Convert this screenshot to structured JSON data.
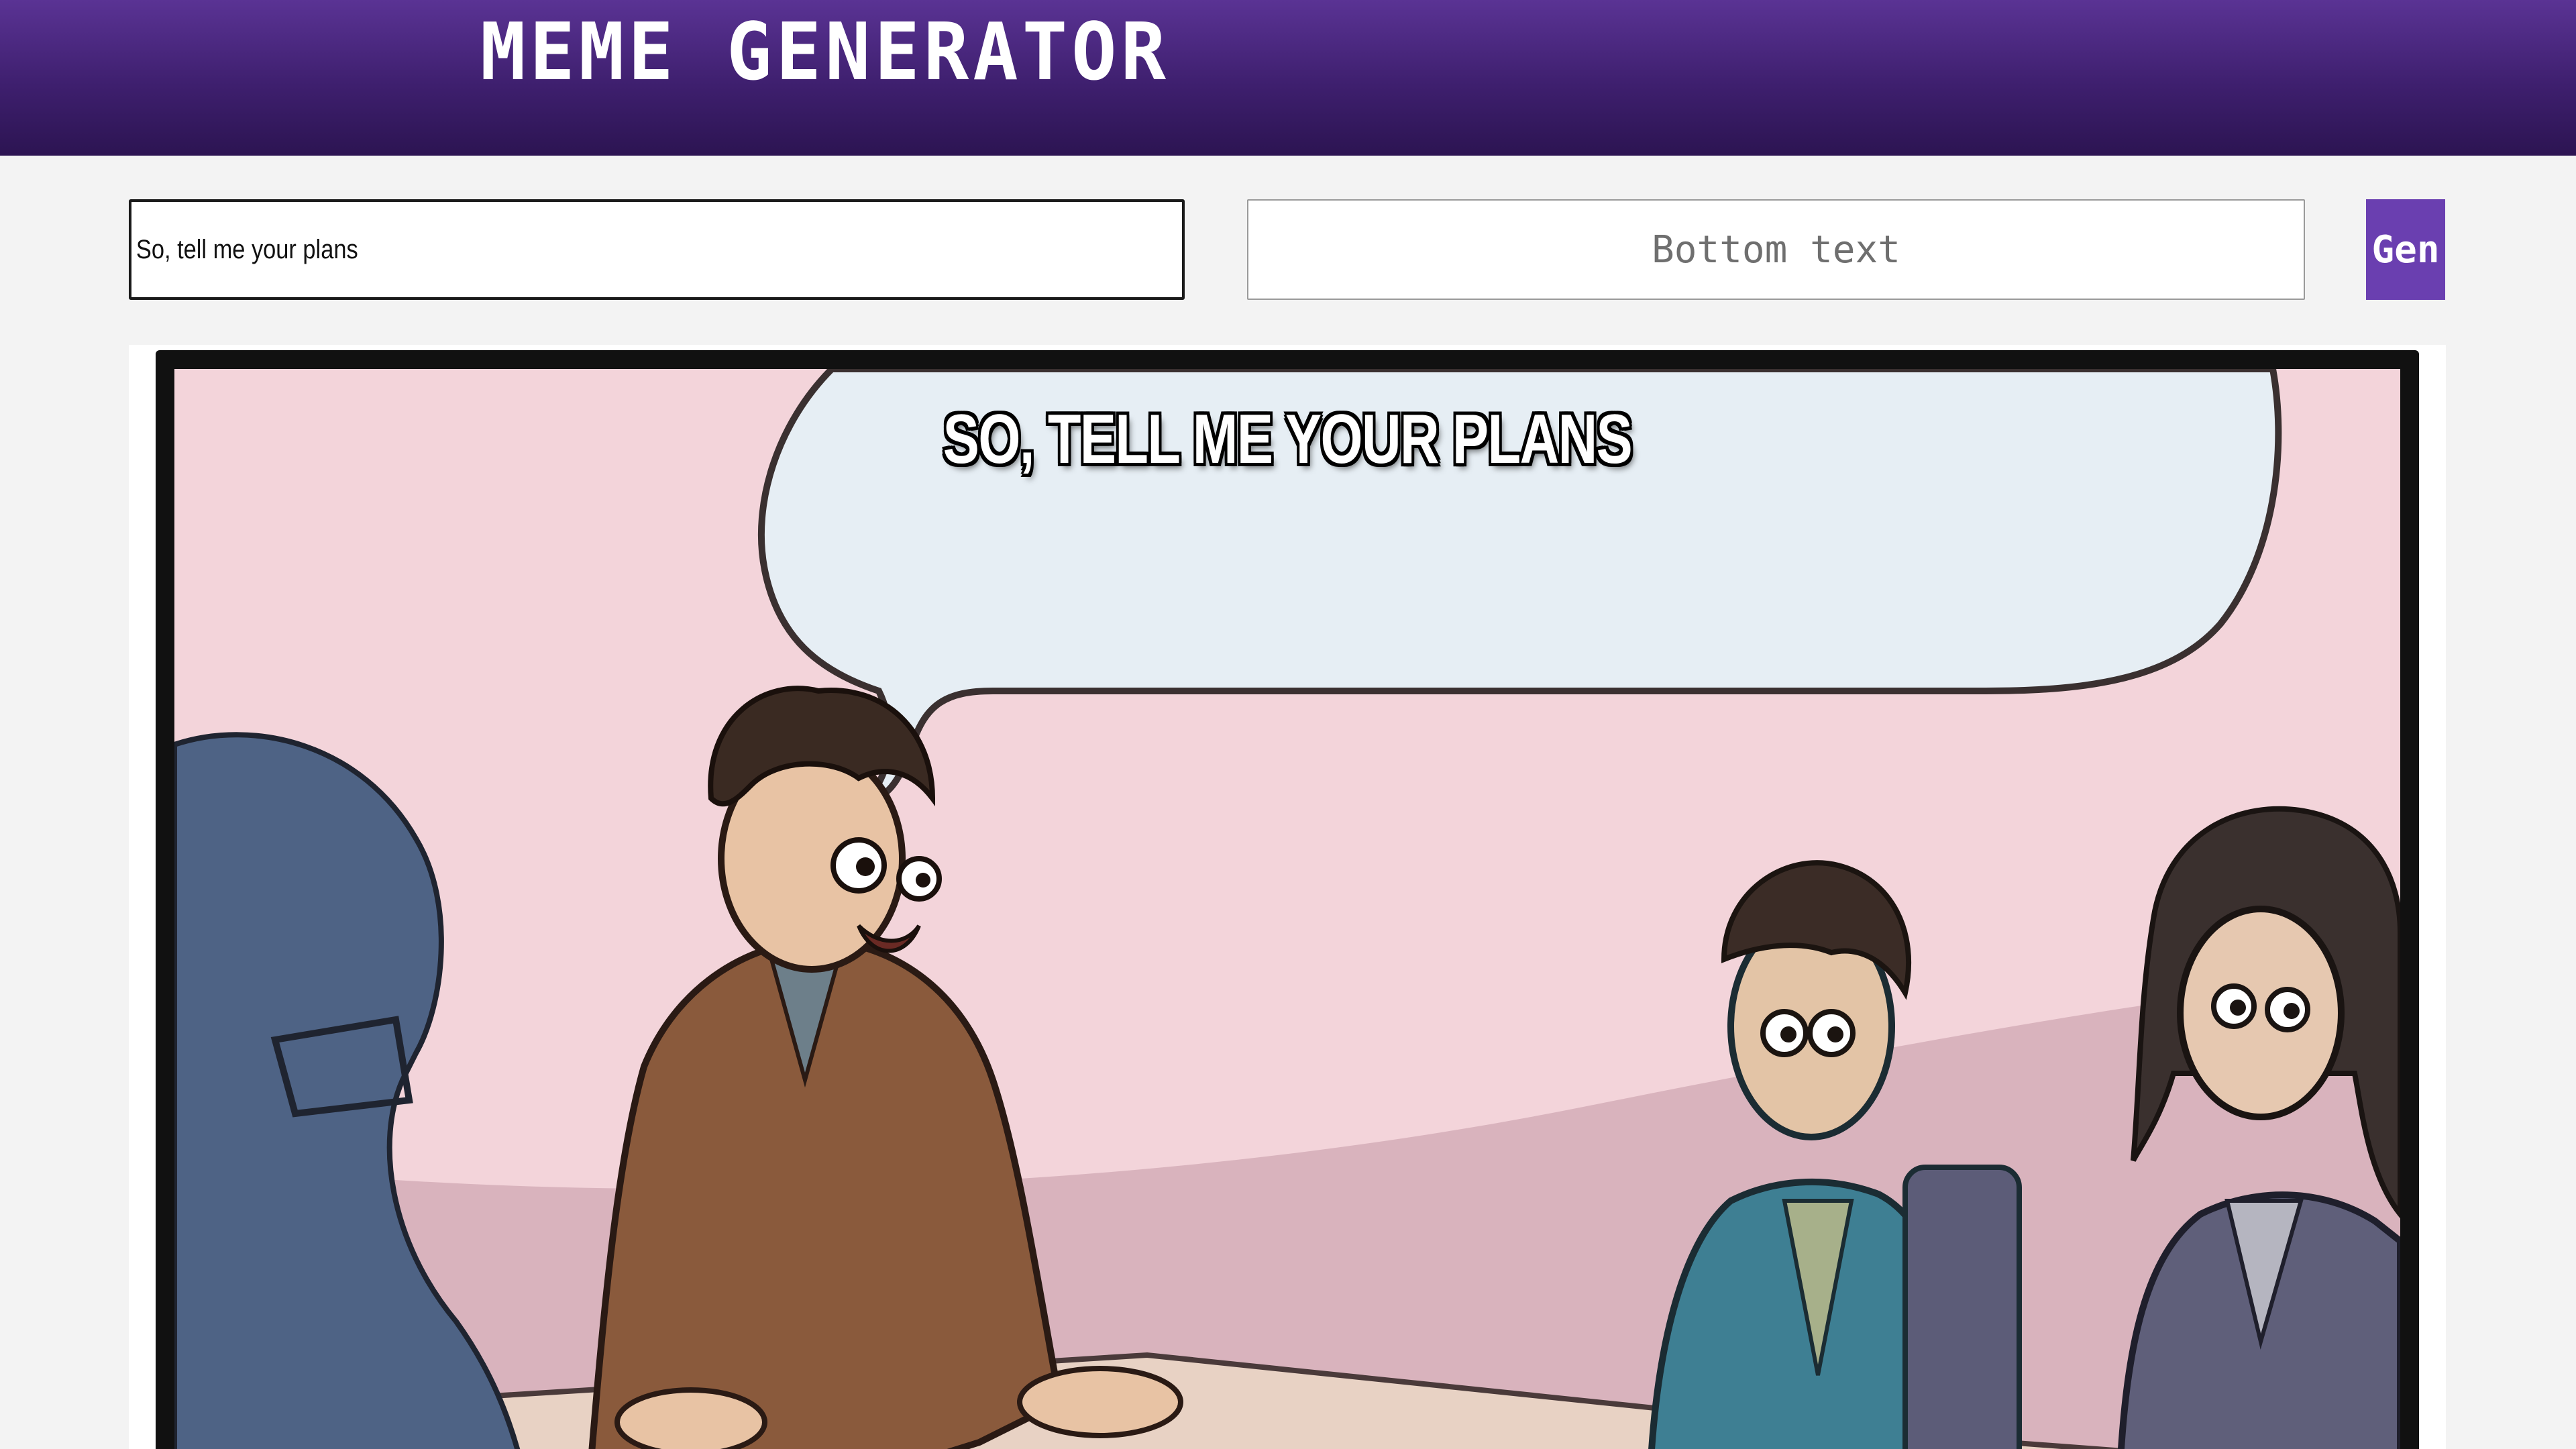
{
  "header": {
    "title": "MEME GENERATOR"
  },
  "form": {
    "top_text_value": "So, tell me your plans",
    "bottom_text_placeholder": "Bottom text",
    "bottom_text_value": "",
    "generate_label": "Gen"
  },
  "meme": {
    "template": "boardroom-meeting-comic",
    "top_caption": "SO, TELL ME YOUR PLANS",
    "bottom_caption": ""
  },
  "colors": {
    "header_top": "#5a3394",
    "header_bottom": "#2c1452",
    "button": "#6a3fb0",
    "page_background": "#f3f3f3"
  }
}
